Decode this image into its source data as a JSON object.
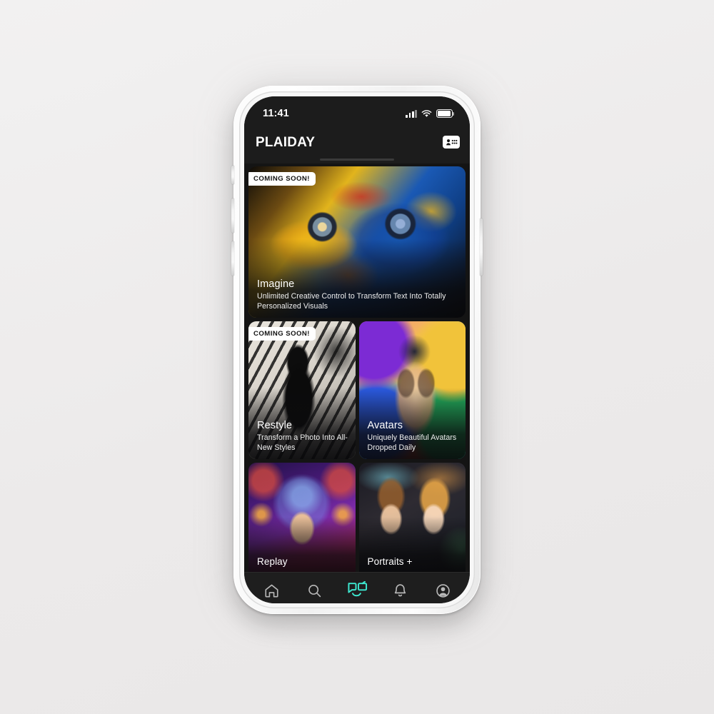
{
  "status_bar": {
    "time": "11:41",
    "signal_icon": "cellular-signal-icon",
    "wifi_icon": "wifi-icon",
    "battery_icon": "battery-icon"
  },
  "header": {
    "brand": "PLAIDAY",
    "action_icon": "contacts-people-icon"
  },
  "colors": {
    "accent_cyan": "#3DE8D0",
    "screen_bg": "#141414",
    "chrome_bg": "#1C1C1C",
    "page_bg": "#EFEEEE",
    "badge_bg": "#FFFFFF"
  },
  "cards": [
    {
      "id": "imagine",
      "badge": "COMING SOON!",
      "title": "Imagine",
      "subtitle": "Unlimited Creative Control to Transform Text Into Totally Personalized Visuals",
      "art_name": "painted-face-blue-yellow-artwork"
    },
    {
      "id": "restyle",
      "badge": "COMING SOON!",
      "title": "Restyle",
      "subtitle": "Transform a Photo Into All-New Styles",
      "art_name": "black-white-silhouette-artwork"
    },
    {
      "id": "avatars",
      "badge": "",
      "title": "Avatars",
      "subtitle": "Uniquely Beautiful Avatars Dropped Daily",
      "art_name": "colorful-pop-art-portrait-artwork"
    },
    {
      "id": "replay",
      "badge": "",
      "title": "Replay",
      "subtitle": "",
      "art_name": "cosmic-crown-woman-artwork"
    },
    {
      "id": "portraits",
      "badge": "",
      "title": "Portraits +",
      "subtitle": "",
      "art_name": "royal-couple-rainbow-artwork"
    }
  ],
  "tabbar": {
    "items": [
      {
        "id": "home",
        "icon": "home-icon",
        "active": false
      },
      {
        "id": "search",
        "icon": "search-icon",
        "active": false
      },
      {
        "id": "create",
        "icon": "plaiday-logo-icon",
        "active": true
      },
      {
        "id": "alerts",
        "icon": "bell-icon",
        "active": false
      },
      {
        "id": "profile",
        "icon": "profile-avatar-icon",
        "active": false
      }
    ]
  }
}
